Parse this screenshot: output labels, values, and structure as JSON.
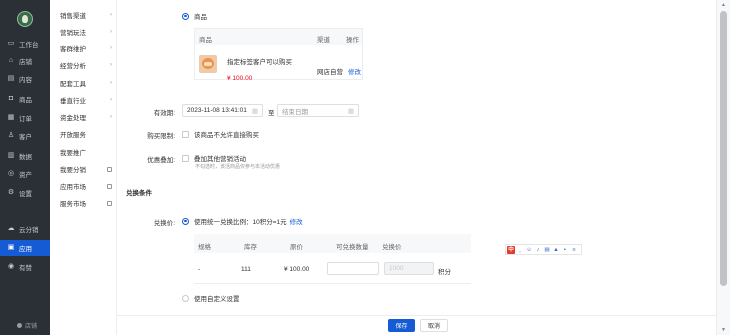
{
  "sidebar": {
    "items": [
      {
        "label": "工作台",
        "icon": "desktop-icon"
      },
      {
        "label": "店铺",
        "icon": "shop-icon"
      },
      {
        "label": "内容",
        "icon": "document-icon"
      },
      {
        "label": "商品",
        "icon": "bag-icon"
      },
      {
        "label": "订单",
        "icon": "order-icon"
      },
      {
        "label": "客户",
        "icon": "user-icon"
      },
      {
        "label": "数据",
        "icon": "chart-icon"
      },
      {
        "label": "资产",
        "icon": "wallet-icon"
      },
      {
        "label": "设置",
        "icon": "gear-icon"
      },
      {
        "label": "云分销",
        "icon": "cloud-icon"
      },
      {
        "label": "应用",
        "icon": "grid-icon",
        "active": true
      },
      {
        "label": "有赞",
        "icon": "chat-icon"
      }
    ],
    "bottom_label": "店铺"
  },
  "subnav": {
    "items": [
      {
        "label": "销售渠道",
        "kind": "arrow"
      },
      {
        "label": "营销玩法",
        "kind": "arrow"
      },
      {
        "label": "客群维护",
        "kind": "arrow"
      },
      {
        "label": "经营分析",
        "kind": "arrow"
      },
      {
        "label": "配套工具",
        "kind": "arrow"
      },
      {
        "label": "垂直行业",
        "kind": "arrow"
      },
      {
        "label": "资金处理",
        "kind": "arrow"
      },
      {
        "label": "开放服务",
        "kind": "none"
      },
      {
        "label": "我要推广",
        "kind": "none"
      },
      {
        "label": "我要分销",
        "kind": "ext"
      },
      {
        "label": "应用市场",
        "kind": "ext"
      },
      {
        "label": "服务市场",
        "kind": "ext"
      }
    ]
  },
  "form": {
    "goods_radio_label": "商品",
    "goods_table": {
      "headers": [
        "商品",
        "渠道",
        "操作"
      ],
      "row": {
        "name": "指定标签客户可以购买",
        "price": "¥ 100.00",
        "channel": "网店自营",
        "action": "修改"
      }
    },
    "validity": {
      "label": "有效期:",
      "start": "2023-11-08 13:41:01",
      "separator": "至",
      "end_placeholder": "结束日期"
    },
    "purchase_limit": {
      "label": "购买限制:",
      "option": "该商品不允许直接购买"
    },
    "overlay": {
      "label": "优惠叠加:",
      "option": "叠加其他营销活动",
      "hint": "不勾选时，该活商品仅参与本活动优惠"
    },
    "section_title": "兑换条件",
    "exchange": {
      "label": "兑换价:",
      "option": "使用统一兑换比例：10积分=1元",
      "edit": "修改",
      "table_headers": [
        "规格",
        "库存",
        "原价",
        "可兑换数量",
        "兑换价"
      ],
      "row": {
        "spec": "-",
        "stock": "111",
        "price": "¥ 100.00",
        "qty_value": "",
        "points_value": "1000",
        "unit": "积分"
      },
      "custom_option": "使用自定义设置"
    }
  },
  "footer": {
    "save": "保存",
    "cancel": "取消"
  },
  "ime_toolbar": {
    "first": "中"
  },
  "colors": {
    "primary": "#155bd4",
    "sidebar_bg": "#2b2f36",
    "price": "#ee0a24"
  }
}
